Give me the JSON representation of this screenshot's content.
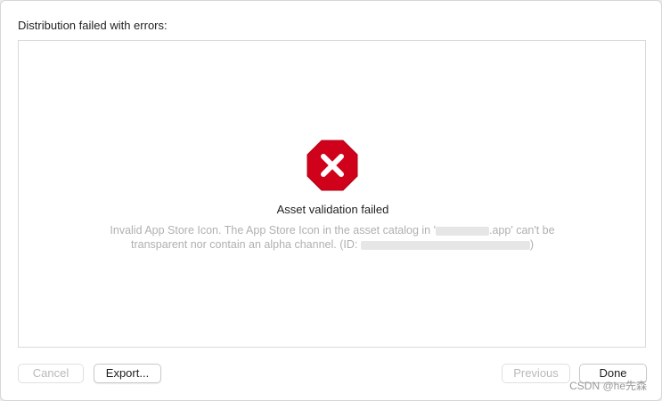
{
  "dialog": {
    "header": "Distribution failed with errors:",
    "error": {
      "icon": "error-x-octagon-icon",
      "title": "Asset validation failed",
      "message_line1_prefix": "Invalid App Store Icon. The App Store Icon in the asset catalog in '",
      "message_line1_suffix": ".app' can't be",
      "message_line2_prefix": "transparent nor contain an alpha channel. (ID:",
      "message_line2_suffix": ")"
    },
    "buttons": {
      "cancel": "Cancel",
      "export": "Export...",
      "previous": "Previous",
      "done": "Done"
    }
  },
  "watermark": "CSDN @he先森",
  "colors": {
    "error_red": "#d0021b",
    "disabled_text": "#b9b9b9"
  }
}
